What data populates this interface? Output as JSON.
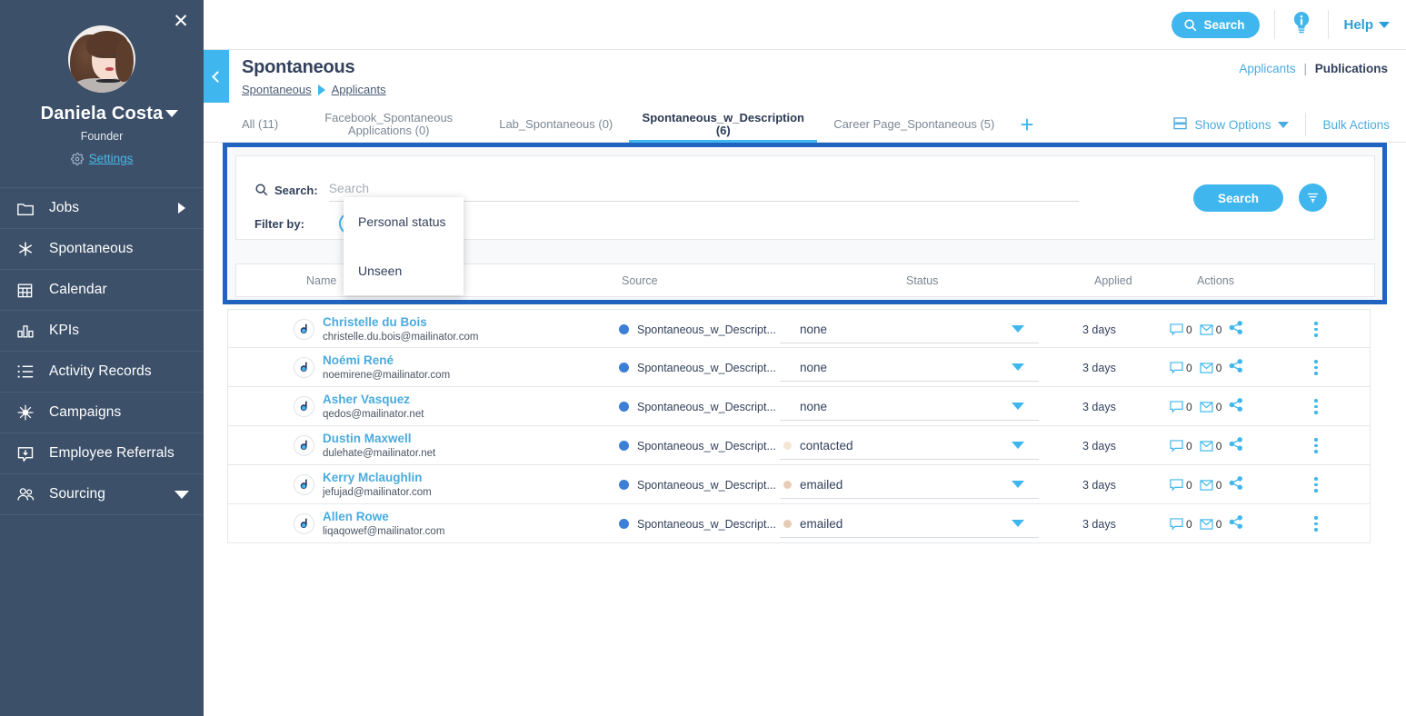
{
  "sidebar": {
    "close_label": "✕",
    "user_name": "Daniela Costa",
    "user_role": "Founder",
    "settings_label": "Settings",
    "items": [
      {
        "label": "Jobs",
        "icon": "folder-icon",
        "chevron": "right"
      },
      {
        "label": "Spontaneous",
        "icon": "asterisk-icon",
        "chevron": "none"
      },
      {
        "label": "Calendar",
        "icon": "calendar-icon",
        "chevron": "none"
      },
      {
        "label": "KPIs",
        "icon": "bar-chart-icon",
        "chevron": "none"
      },
      {
        "label": "Activity Records",
        "icon": "list-icon",
        "chevron": "none"
      },
      {
        "label": "Campaigns",
        "icon": "network-icon",
        "chevron": "none"
      },
      {
        "label": "Employee Referrals",
        "icon": "speech-download-icon",
        "chevron": "none"
      },
      {
        "label": "Sourcing",
        "icon": "people-icon",
        "chevron": "down"
      }
    ]
  },
  "topbar": {
    "search_label": "Search",
    "info_icon": "lightbulb-info-icon",
    "help_label": "Help"
  },
  "page_header": {
    "title": "Spontaneous",
    "breadcrumb": [
      "Spontaneous",
      "Applicants"
    ],
    "right_links": [
      "Applicants",
      "Publications"
    ],
    "right_separator": "|"
  },
  "tabs": {
    "items": [
      {
        "label": "All (11)",
        "active": false
      },
      {
        "label": "Facebook_Spontaneous Applications (0)",
        "active": false
      },
      {
        "label": "Lab_Spontaneous (0)",
        "active": false
      },
      {
        "label": "Spontaneous_w_Description (6)",
        "active": true
      },
      {
        "label": "Career Page_Spontaneous (5)",
        "active": false
      }
    ],
    "add_label": "+",
    "show_options_label": "Show Options",
    "bulk_actions_label": "Bulk Actions"
  },
  "filter_panel": {
    "search_label": "Search:",
    "search_value": "",
    "search_placeholder": "Search",
    "filter_by_label": "Filter by:",
    "add_filter_label": "+",
    "search_button_label": "Search",
    "funnel_icon": "filter-funnel-icon",
    "dropdown_options": [
      "Personal status",
      "Unseen"
    ]
  },
  "table": {
    "columns": [
      "Name",
      "Source",
      "Status",
      "Applied",
      "Actions"
    ],
    "rows": [
      {
        "name": "Christelle du Bois",
        "email": "christelle.du.bois@mailinator.com",
        "source": "Spontaneous_w_Descript...",
        "status": "none",
        "status_dot": "none",
        "applied": "3 days",
        "comments": "0",
        "emails": "0"
      },
      {
        "name": "Noémi René",
        "email": "noemirene@mailinator.com",
        "source": "Spontaneous_w_Descript...",
        "status": "none",
        "status_dot": "none",
        "applied": "3 days",
        "comments": "0",
        "emails": "0"
      },
      {
        "name": "Asher Vasquez",
        "email": "qedos@mailinator.net",
        "source": "Spontaneous_w_Descript...",
        "status": "none",
        "status_dot": "none",
        "applied": "3 days",
        "comments": "0",
        "emails": "0"
      },
      {
        "name": "Dustin Maxwell",
        "email": "dulehate@mailinator.net",
        "source": "Spontaneous_w_Descript...",
        "status": "contacted",
        "status_dot": "#f3e6d2",
        "applied": "3 days",
        "comments": "0",
        "emails": "0"
      },
      {
        "name": "Kerry Mclaughlin",
        "email": "jefujad@mailinator.com",
        "source": "Spontaneous_w_Descript...",
        "status": "emailed",
        "status_dot": "#e8cdb8",
        "applied": "3 days",
        "comments": "0",
        "emails": "0"
      },
      {
        "name": "Allen Rowe",
        "email": "liqaqowef@mailinator.com",
        "source": "Spontaneous_w_Descript...",
        "status": "emailed",
        "status_dot": "#e6cbb5",
        "applied": "3 days",
        "comments": "0",
        "emails": "0"
      }
    ]
  },
  "colors": {
    "accent_blue": "#3fb7ee",
    "sidebar_bg": "#3c5069",
    "highlight_border": "#2164c0",
    "source_dot": "#3d7fd6",
    "link": "#4aabdf"
  }
}
